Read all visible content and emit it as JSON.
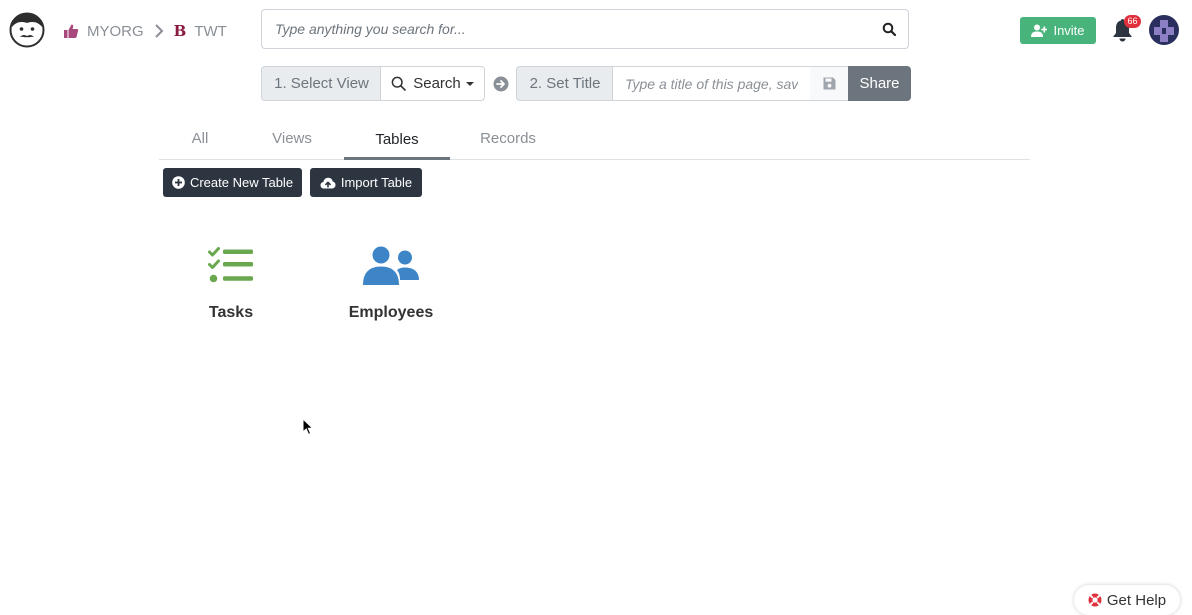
{
  "header": {
    "org": "MYORG",
    "project": "TWT",
    "project_icon_letter": "B",
    "search_placeholder": "Type anything you search for...",
    "invite_label": "Invite",
    "notification_count": "66"
  },
  "toolbar": {
    "select_view_label": "1. Select View",
    "view_dropdown_label": "Search",
    "set_title_label": "2. Set Title",
    "title_placeholder": "Type a title of this page, save",
    "share_label": "Share"
  },
  "tabs": [
    {
      "label": "All",
      "active": false
    },
    {
      "label": "Views",
      "active": false
    },
    {
      "label": "Tables",
      "active": true
    },
    {
      "label": "Records",
      "active": false
    }
  ],
  "actions": {
    "create_table_label": "Create New Table",
    "import_table_label": "Import Table"
  },
  "tables": [
    {
      "name": "Tasks",
      "icon": "tasks-icon",
      "color": "#6aa84f"
    },
    {
      "name": "Employees",
      "icon": "users-icon",
      "color": "#3d85c6"
    }
  ],
  "help": {
    "label": "Get Help"
  },
  "colors": {
    "invite": "#48b47c",
    "dark_button": "#2d3540",
    "badge": "#e0303b",
    "share": "#6c757d"
  }
}
